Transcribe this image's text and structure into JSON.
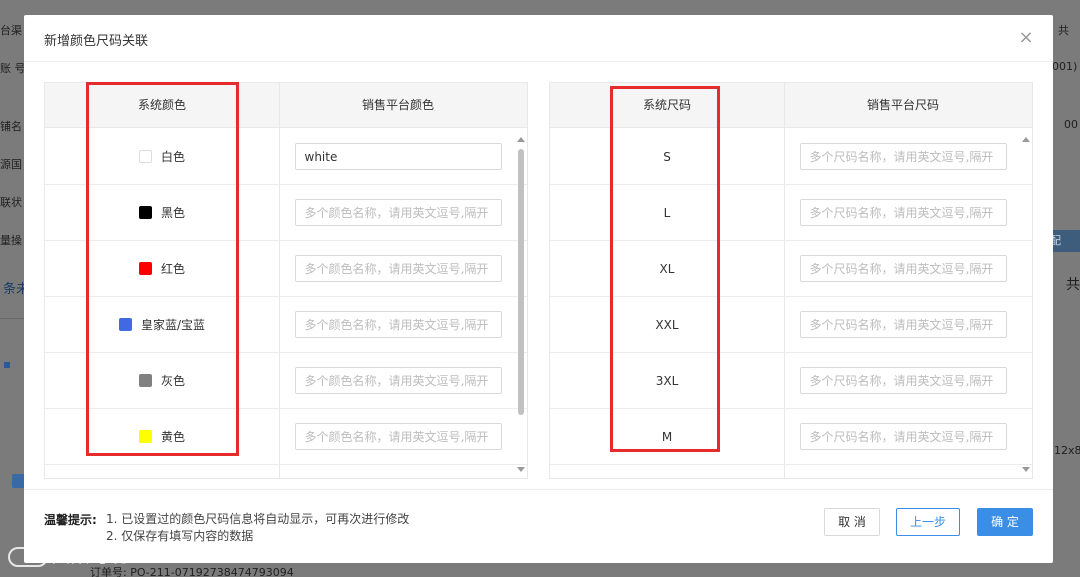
{
  "background": {
    "fragments": [
      "台渠",
      "账 号",
      "铺名",
      "源国",
      "联状",
      "量操",
      "条未",
      "共",
      "001)",
      "00",
      "共",
      "配",
      "12x8",
      "订单号: PO-211-071927384747930​94"
    ]
  },
  "watermark": {
    "text": "大数跨境"
  },
  "modal": {
    "title": "新增颜色尺码关联",
    "close_icon": "×",
    "color_table": {
      "header_system": "系统颜色",
      "header_platform": "销售平台颜色",
      "rows": [
        {
          "name": "白色",
          "swatch": "#ffffff",
          "value": "white",
          "placeholder": "多个颜色名称，请用英文逗号,隔开"
        },
        {
          "name": "黑色",
          "swatch": "#000000",
          "value": "",
          "placeholder": "多个颜色名称，请用英文逗号,隔开"
        },
        {
          "name": "红色",
          "swatch": "#ff0000",
          "value": "",
          "placeholder": "多个颜色名称，请用英文逗号,隔开"
        },
        {
          "name": "皇家蓝/宝蓝",
          "swatch": "#4169e1",
          "value": "",
          "placeholder": "多个颜色名称，请用英文逗号,隔开"
        },
        {
          "name": "灰色",
          "swatch": "#808080",
          "value": "",
          "placeholder": "多个颜色名称，请用英文逗号,隔开"
        },
        {
          "name": "黄色",
          "swatch": "#ffff00",
          "value": "",
          "placeholder": "多个颜色名称，请用英文逗号,隔开"
        }
      ]
    },
    "size_table": {
      "header_system": "系统尺码",
      "header_platform": "销售平台尺码",
      "rows": [
        {
          "name": "S",
          "value": "",
          "placeholder": "多个尺码名称，请用英文逗号,隔开"
        },
        {
          "name": "L",
          "value": "",
          "placeholder": "多个尺码名称，请用英文逗号,隔开"
        },
        {
          "name": "XL",
          "value": "",
          "placeholder": "多个尺码名称，请用英文逗号,隔开"
        },
        {
          "name": "XXL",
          "value": "",
          "placeholder": "多个尺码名称，请用英文逗号,隔开"
        },
        {
          "name": "3XL",
          "value": "",
          "placeholder": "多个尺码名称，请用英文逗号,隔开"
        },
        {
          "name": "M",
          "value": "",
          "placeholder": "多个尺码名称，请用英文逗号,隔开"
        }
      ]
    },
    "footer": {
      "tip_label": "温馨提示:",
      "tip_1": "1. 已设置过的颜色尺码信息将自动显示，可再次进行修改",
      "tip_2": "2. 仅保存有填写内容的数据",
      "cancel_label": "取 消",
      "prev_label": "上一步",
      "ok_label": "确 定"
    },
    "colors": {
      "accent": "#3a8ee6",
      "highlight_box": "#e52b2b"
    }
  }
}
